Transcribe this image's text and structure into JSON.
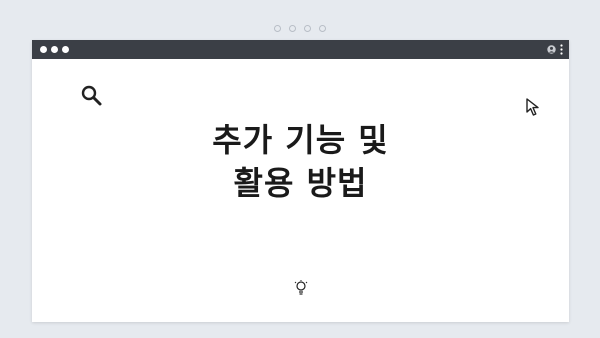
{
  "window": {
    "titlebar_color": "#3b3f46",
    "background_color": "#ffffff"
  },
  "slide": {
    "title_line1": "추가 기능 및",
    "title_line2": "활용 방법"
  },
  "icons": {
    "top_left": "search-icon",
    "top_right": "cursor-icon",
    "bottom_center": "lightbulb-icon",
    "titlebar_right": [
      "avatar-icon",
      "more-icon"
    ]
  }
}
